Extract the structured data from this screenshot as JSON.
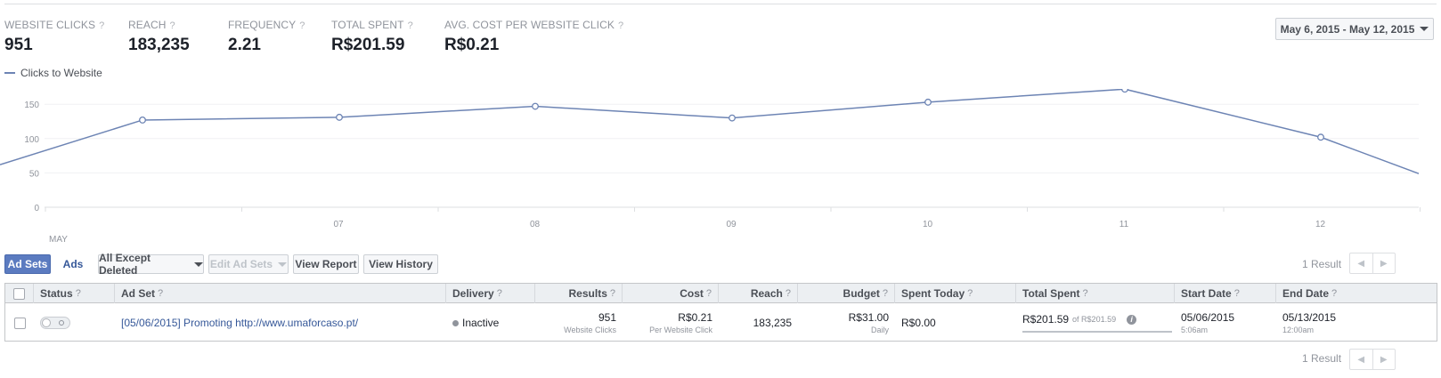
{
  "metrics": [
    {
      "label": "WEBSITE CLICKS",
      "value": "951"
    },
    {
      "label": "REACH",
      "value": "183,235"
    },
    {
      "label": "FREQUENCY",
      "value": "2.21"
    },
    {
      "label": "TOTAL SPENT",
      "value": "R$201.59"
    },
    {
      "label": "AVG. COST PER WEBSITE CLICK",
      "value": "R$0.21"
    }
  ],
  "help_mark": "?",
  "date_range": "May 6, 2015 - May 12, 2015",
  "chart_data": {
    "type": "line",
    "legend": [
      "Clicks to Website"
    ],
    "x_ticks": [
      "MAY",
      "07",
      "08",
      "09",
      "10",
      "11",
      "12"
    ],
    "y_ticks": [
      "0",
      "50",
      "100",
      "150"
    ],
    "ylim": [
      0,
      200
    ],
    "x": [
      0,
      1,
      2,
      3,
      4,
      5,
      6
    ],
    "series": [
      {
        "name": "Clicks to Website",
        "values": [
          127,
          131,
          147,
          130,
          153,
          172,
          102
        ],
        "color": "#6d84b4"
      }
    ],
    "grid": true
  },
  "toolbar": {
    "ad_sets": "Ad Sets",
    "ads": "Ads",
    "filter": "All Except Deleted",
    "edit": "Edit Ad Sets",
    "view_report": "View Report",
    "view_history": "View History"
  },
  "result_count": "1 Result",
  "table": {
    "headers": [
      "Status",
      "Ad Set",
      "Delivery",
      "Results",
      "Cost",
      "Reach",
      "Budget",
      "Spent Today",
      "Total Spent",
      "Start Date",
      "End Date"
    ],
    "row": {
      "ad_set": "[05/06/2015] Promoting http://www.umaforcaso.pt/",
      "delivery": "Inactive",
      "results": "951",
      "results_sub": "Website Clicks",
      "cost": "R$0.21",
      "cost_sub": "Per Website Click",
      "reach": "183,235",
      "budget": "R$31.00",
      "budget_sub": "Daily",
      "spent_today": "R$0.00",
      "total_spent": "R$201.59",
      "total_spent_of": "of R$201.59",
      "start_date": "05/06/2015",
      "start_time": "5:06am",
      "end_date": "05/13/2015",
      "end_time": "12:00am"
    }
  }
}
